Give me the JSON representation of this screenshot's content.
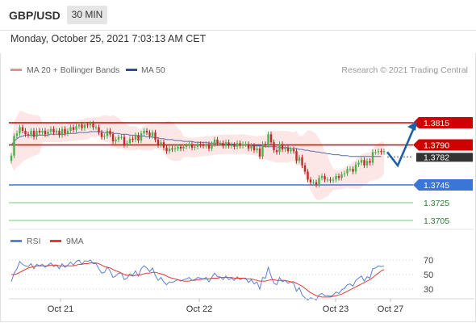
{
  "header": {
    "pair": "GBP/USD",
    "timeframe": "30 MIN",
    "datetime": "Monday, October 25, 2021 7:03:13 AM CET"
  },
  "legend": {
    "bollinger_label": "MA 20 + Bollinger Bands",
    "ma50_label": "MA 50",
    "credit": "Research © 2021 Trading Central"
  },
  "rsi_legend": {
    "rsi_label": "RSI",
    "ma_label": "9MA"
  },
  "colors": {
    "bollinger": "#f28b8b",
    "bollinger_fill": "#fde2e2",
    "ma50": "#2f4f8f",
    "up": "#4caf50",
    "down": "#c62828",
    "resistance": "#d00000",
    "support": "#3a75d8",
    "target": "#7bc47f",
    "rsi": "#5b7fd6",
    "rsi_ma": "#e53935",
    "arrow": "#1f5fa8"
  },
  "chart_data": {
    "type": "candlestick",
    "x_ticks": [
      "Oct 21",
      "Oct 22",
      "Oct 23",
      "Oct 27"
    ],
    "current_price": "1.3782",
    "levels": [
      {
        "label": "1.3815",
        "value": 1.3815,
        "kind": "resistance"
      },
      {
        "label": "1.3790",
        "value": 1.379,
        "kind": "resistance"
      },
      {
        "label": "1.3745",
        "value": 1.3745,
        "kind": "support"
      },
      {
        "label": "1.3725",
        "value": 1.3725,
        "kind": "target"
      },
      {
        "label": "1.3705",
        "value": 1.3705,
        "kind": "target"
      }
    ],
    "close": [
      1.3778,
      1.38,
      1.3803,
      1.381,
      1.3806,
      1.3802,
      1.3801,
      1.3806,
      1.3799,
      1.3806,
      1.3804,
      1.3806,
      1.3802,
      1.3805,
      1.3808,
      1.3804,
      1.3806,
      1.3801,
      1.3808,
      1.3803,
      1.3806,
      1.381,
      1.3807,
      1.3811,
      1.3813,
      1.3809,
      1.3813,
      1.3812,
      1.3814,
      1.381,
      1.381,
      1.3804,
      1.3799,
      1.38,
      1.3806,
      1.3802,
      1.3794,
      1.3796,
      1.3799,
      1.3799,
      1.379,
      1.3792,
      1.3797,
      1.3796,
      1.3801,
      1.3795,
      1.3803,
      1.3806,
      1.3804,
      1.38,
      1.3804,
      1.3796,
      1.379,
      1.3793,
      1.3787,
      1.3783,
      1.3786,
      1.3785,
      1.3786,
      1.3788,
      1.3786,
      1.3788,
      1.3789,
      1.3791,
      1.3787,
      1.3788,
      1.3791,
      1.379,
      1.3789,
      1.3791,
      1.3786,
      1.3791,
      1.3796,
      1.3792,
      1.3792,
      1.3789,
      1.3793,
      1.3789,
      1.379,
      1.3788,
      1.3792,
      1.3789,
      1.3791,
      1.3791,
      1.3786,
      1.3789,
      1.3784,
      1.3786,
      1.3777,
      1.3791,
      1.379,
      1.3802,
      1.3793,
      1.3784,
      1.3782,
      1.3791,
      1.3785,
      1.3787,
      1.3783,
      1.3785,
      1.3783,
      1.3772,
      1.3776,
      1.3767,
      1.376,
      1.3751,
      1.3748,
      1.3748,
      1.3745,
      1.3753,
      1.3755,
      1.3751,
      1.3751,
      1.375,
      1.3751,
      1.3755,
      1.3753,
      1.3757,
      1.3758,
      1.3763,
      1.3763,
      1.376,
      1.3768,
      1.377,
      1.3773,
      1.3767,
      1.3772,
      1.377,
      1.3782,
      1.3782,
      1.3783,
      1.3782,
      1.3783
    ],
    "ma50": [
      1.379,
      1.3794,
      1.3797,
      1.3799,
      1.38,
      1.3801,
      1.3801,
      1.3801,
      1.3801,
      1.3801,
      1.3801,
      1.3801,
      1.3801,
      1.3801,
      1.3802,
      1.3802,
      1.3802,
      1.3802,
      1.3802,
      1.3802,
      1.3803,
      1.3803,
      1.3803,
      1.3803,
      1.3804,
      1.3804,
      1.3804,
      1.3804,
      1.3805,
      1.3805,
      1.3805,
      1.3805,
      1.3805,
      1.3804,
      1.3804,
      1.3804,
      1.3803,
      1.3803,
      1.3803,
      1.3802,
      1.3802,
      1.3802,
      1.3801,
      1.3801,
      1.3801,
      1.38,
      1.38,
      1.38,
      1.3799,
      1.3799,
      1.3799,
      1.3798,
      1.3798,
      1.3797,
      1.3797,
      1.3796,
      1.3796,
      1.3796,
      1.3795,
      1.3795,
      1.3795,
      1.3794,
      1.3794,
      1.3794,
      1.3794,
      1.3793,
      1.3793,
      1.3793,
      1.3793,
      1.3793,
      1.3792,
      1.3792,
      1.3792,
      1.3792,
      1.3792,
      1.3791,
      1.3791,
      1.3791,
      1.3791,
      1.3791,
      1.379,
      1.379,
      1.379,
      1.379,
      1.379,
      1.3789,
      1.3789,
      1.3789,
      1.3789,
      1.3789,
      1.3788,
      1.3788,
      1.3788,
      1.3788,
      1.3788,
      1.3787,
      1.3787,
      1.3787,
      1.3787,
      1.3786,
      1.3786,
      1.3786,
      1.3785,
      1.3785,
      1.3784,
      1.3784,
      1.3783,
      1.3783,
      1.3782,
      1.3782,
      1.3781,
      1.3781,
      1.378,
      1.378,
      1.3779,
      1.3779,
      1.3779,
      1.3778,
      1.3778,
      1.3778,
      1.3777,
      1.3777,
      1.3777,
      1.3777,
      1.3777,
      1.3777,
      1.3777,
      1.3777,
      1.3777,
      1.3777,
      1.3777,
      1.3777
    ],
    "rsi": [
      40,
      52,
      58,
      68,
      64,
      62,
      61,
      65,
      58,
      64,
      62,
      64,
      60,
      63,
      66,
      61,
      63,
      58,
      65,
      60,
      63,
      67,
      63,
      68,
      70,
      64,
      69,
      68,
      70,
      65,
      65,
      58,
      52,
      53,
      60,
      55,
      46,
      48,
      52,
      52,
      43,
      45,
      51,
      49,
      55,
      48,
      58,
      62,
      59,
      54,
      59,
      49,
      42,
      46,
      40,
      36,
      40,
      39,
      41,
      43,
      41,
      43,
      44,
      46,
      42,
      43,
      46,
      45,
      44,
      46,
      40,
      46,
      52,
      47,
      47,
      43,
      48,
      43,
      45,
      42,
      47,
      43,
      45,
      45,
      39,
      43,
      37,
      40,
      30,
      46,
      45,
      60,
      48,
      38,
      36,
      46,
      40,
      42,
      38,
      40,
      38,
      27,
      32,
      22,
      18,
      15,
      18,
      17,
      15,
      22,
      24,
      21,
      21,
      20,
      22,
      26,
      24,
      29,
      31,
      36,
      37,
      34,
      42,
      45,
      48,
      41,
      47,
      45,
      58,
      59,
      62,
      61,
      62
    ],
    "rsi_ma": [
      50,
      50,
      51,
      53,
      55,
      57,
      59,
      60,
      61,
      62,
      62,
      62,
      62,
      62,
      63,
      63,
      63,
      62,
      62,
      62,
      62,
      62,
      62,
      63,
      64,
      64,
      65,
      65,
      66,
      66,
      66,
      65,
      63,
      61,
      60,
      59,
      57,
      55,
      54,
      52,
      50,
      49,
      49,
      48,
      49,
      49,
      50,
      51,
      52,
      52,
      53,
      53,
      52,
      51,
      50,
      48,
      46,
      45,
      44,
      43,
      42,
      41,
      41,
      41,
      42,
      42,
      43,
      43,
      44,
      44,
      44,
      45,
      45,
      45,
      46,
      46,
      46,
      46,
      46,
      45,
      45,
      45,
      45,
      44,
      44,
      44,
      43,
      42,
      41,
      41,
      41,
      42,
      43,
      43,
      42,
      42,
      42,
      42,
      41,
      40,
      40,
      38,
      36,
      34,
      31,
      28,
      25,
      23,
      21,
      20,
      19,
      19,
      19,
      19,
      20,
      21,
      22,
      23,
      25,
      27,
      29,
      31,
      33,
      35,
      37,
      39,
      41,
      43,
      46,
      49,
      52,
      55,
      57
    ],
    "rsi_axis": [
      "70",
      "50",
      "30"
    ]
  }
}
